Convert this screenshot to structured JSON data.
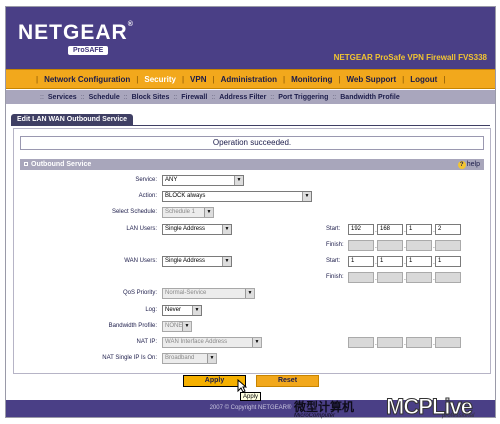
{
  "header": {
    "logo": "NETGEAR",
    "logo_sub": "ProSAFE",
    "product": "NETGEAR ProSafe VPN Firewall FVS338"
  },
  "main_nav": [
    {
      "label": "Network Configuration",
      "active": false
    },
    {
      "label": "Security",
      "active": true
    },
    {
      "label": "VPN",
      "active": false
    },
    {
      "label": "Administration",
      "active": false
    },
    {
      "label": "Monitoring",
      "active": false
    },
    {
      "label": "Web Support",
      "active": false
    },
    {
      "label": "Logout",
      "active": false
    }
  ],
  "sub_nav": [
    "Services",
    "Schedule",
    "Block Sites",
    "Firewall",
    "Address Filter",
    "Port Triggering",
    "Bandwidth Profile"
  ],
  "page_tab": "Edit LAN WAN Outbound Service",
  "message": "Operation succeeded.",
  "section": {
    "title": "Outbound Service",
    "help": "help"
  },
  "form": {
    "service": {
      "label": "Service:",
      "value": "ANY"
    },
    "action": {
      "label": "Action:",
      "value": "BLOCK always"
    },
    "schedule": {
      "label": "Select Schedule:",
      "value": "Schedule 1"
    },
    "lan_users": {
      "label": "LAN Users:",
      "value": "Single Address",
      "start_label": "Start:",
      "finish_label": "Finish:",
      "start": [
        "192",
        "168",
        "1",
        "2"
      ]
    },
    "wan_users": {
      "label": "WAN Users:",
      "value": "Single Address",
      "start_label": "Start:",
      "finish_label": "Finish:",
      "start": [
        "1",
        "1",
        "1",
        "1"
      ]
    },
    "qos": {
      "label": "QoS Priority:",
      "value": "Normal-Service"
    },
    "log": {
      "label": "Log:",
      "value": "Never"
    },
    "bandwidth": {
      "label": "Bandwidth Profile:",
      "value": "NONE"
    },
    "nat_ip": {
      "label": "NAT IP:",
      "value": "WAN Interface Address"
    },
    "nat_single": {
      "label": "NAT Single IP Is On:",
      "value": "Broadband"
    }
  },
  "buttons": {
    "apply": "Apply",
    "reset": "Reset"
  },
  "tooltip": "Apply",
  "footer": "2007 © Copyright NETGEAR®",
  "watermark": {
    "cn": "微型计算机",
    "en": "MicroComputer",
    "logo": "MCPLive",
    "sub": "professional"
  }
}
